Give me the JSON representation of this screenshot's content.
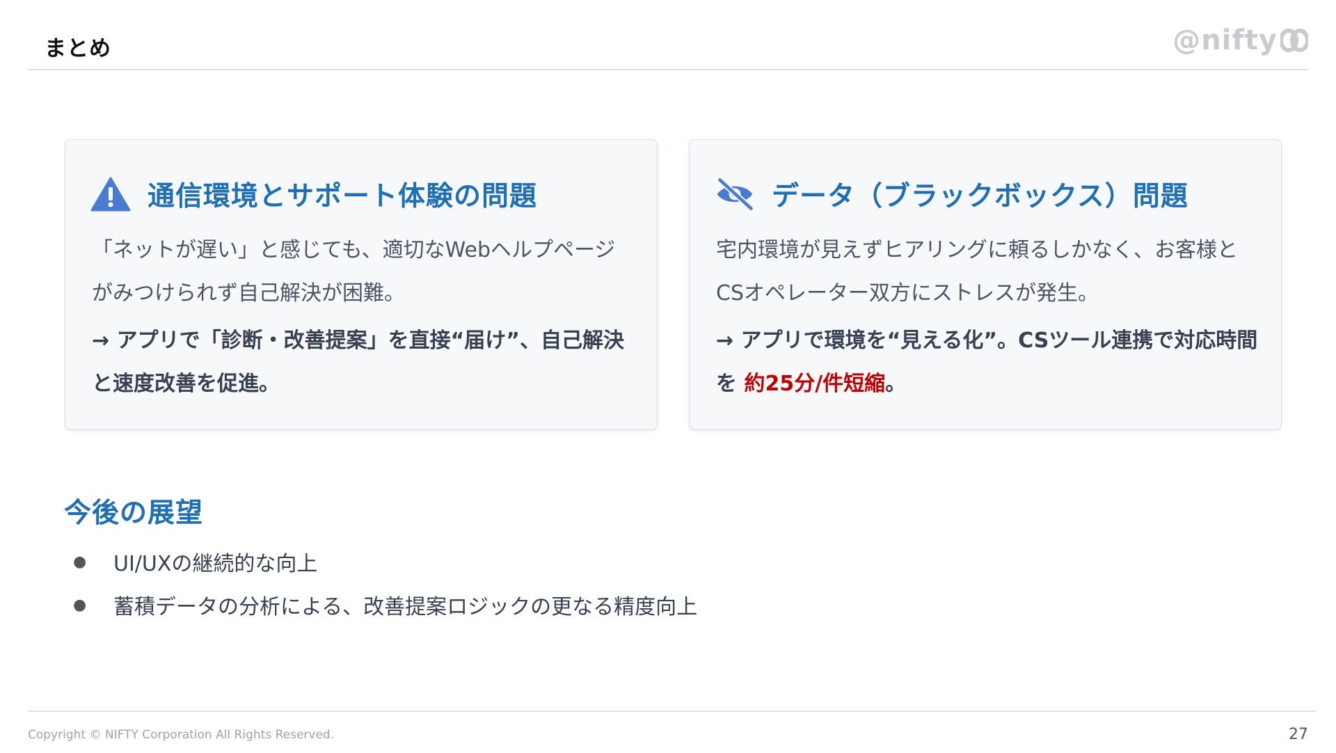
{
  "header": {
    "title": "まとめ",
    "logo_text": "@nifty"
  },
  "cards": [
    {
      "icon": "warning-triangle-icon",
      "icon_color": "#4a7bd0",
      "title": "通信環境とサポート体験の問題",
      "description": "「ネットが遅い」と感じても、適切なWebヘルプページがみつけられず自己解決が困難。",
      "action": "→ アプリで「診断・改善提案」を直接“届け”、自己解決と速度改善を促進。"
    },
    {
      "icon": "eye-slash-icon",
      "icon_color": "#4a7bd0",
      "title": "データ（ブラックボックス）問題",
      "description": "宅内環境が見えずヒアリングに頼るしかなく、お客様とCSオペレーター双方にストレスが発生。",
      "action_before": "→ アプリで環境を“見える化”。CSツール連携で対応時間を ",
      "action_highlight": "約25分/件短縮",
      "action_after": "。",
      "highlight_color": "#c00000"
    }
  ],
  "outlook": {
    "title": "今後の展望",
    "bullet": "●",
    "items": [
      "UI/UXの継続的な向上",
      "蓄積データの分析による、改善提案ロジックの更なる精度向上"
    ]
  },
  "footer": {
    "copyright": "Copyright © NIFTY Corporation All Rights Reserved.",
    "page_number": "27"
  },
  "colors": {
    "accent": "#1f6fb2",
    "card_background": "#f6f8fa",
    "logo": "#c9cbcf"
  }
}
